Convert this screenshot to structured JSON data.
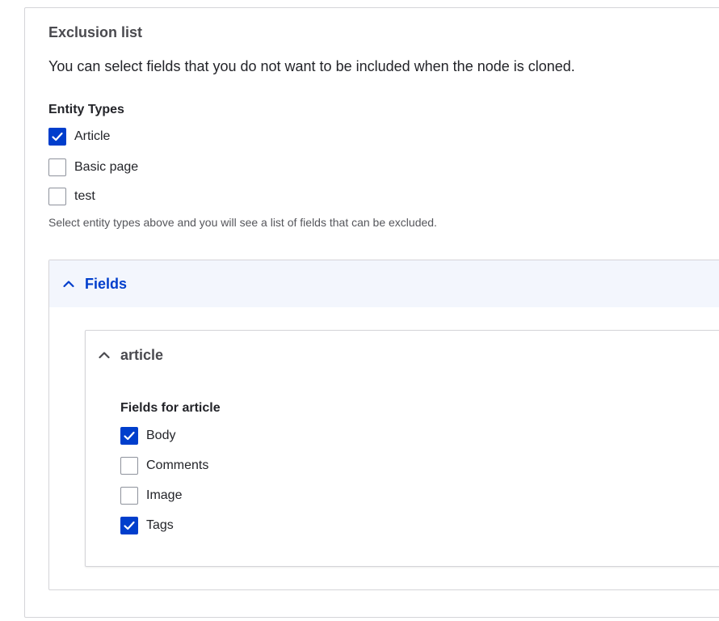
{
  "exclusion": {
    "title": "Exclusion list",
    "description": "You can select fields that you do not want to be included when the node is cloned."
  },
  "entity_types": {
    "label": "Entity Types",
    "options": [
      {
        "label": "Article",
        "checked": true
      },
      {
        "label": "Basic page",
        "checked": false
      },
      {
        "label": "test",
        "checked": false
      }
    ],
    "help": "Select entity types above and you will see a list of fields that can be excluded."
  },
  "fields_details": {
    "title": "Fields",
    "expanded": true,
    "article": {
      "title": "article",
      "expanded": true,
      "group_label": "Fields for article",
      "options": [
        {
          "label": "Body",
          "checked": true
        },
        {
          "label": "Comments",
          "checked": false
        },
        {
          "label": "Image",
          "checked": false
        },
        {
          "label": "Tags",
          "checked": true
        }
      ]
    }
  },
  "colors": {
    "accent": "#003ecc",
    "summary_bg": "#f3f6fd",
    "border": "#d4d4d8"
  },
  "icons": {
    "check": "check-icon",
    "chevron": "chevron-up-icon"
  }
}
